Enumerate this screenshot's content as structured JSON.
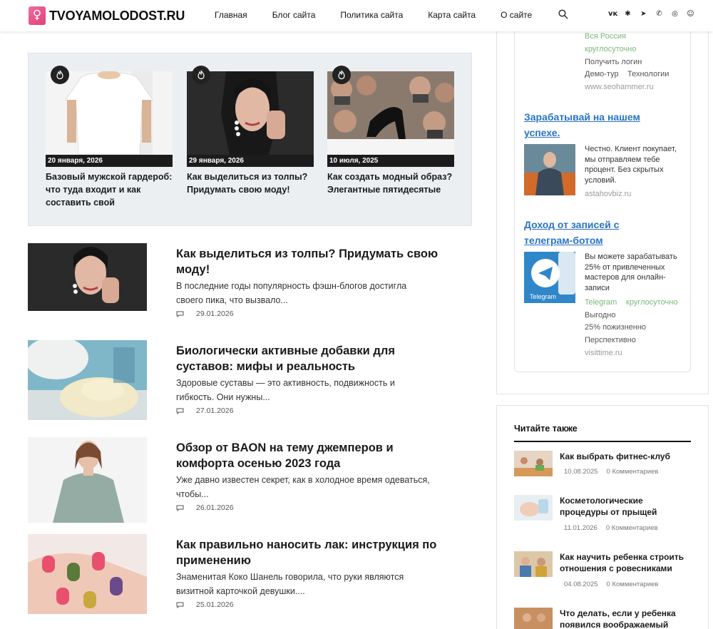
{
  "site": {
    "logo_text": "TVOYAMOLODOST.RU",
    "nav": [
      "Главная",
      "Блог сайта",
      "Политика сайта",
      "Карта сайта",
      "О сайте"
    ],
    "icons": [
      "search-icon",
      "vk-icon",
      "odnoklassniki-icon",
      "telegram-icon",
      "viber-icon",
      "whatsapp-icon",
      "yandex-zen-icon"
    ]
  },
  "featured": [
    {
      "date": "20 января, 2026",
      "title": "Базовый мужской гардероб: что туда входит и как составить свой"
    },
    {
      "date": "29 января, 2026",
      "title": "Как выделиться из толпы? Придумать свою моду!"
    },
    {
      "date": "10 июля, 2025",
      "title": "Как создать модный образ? Элегантные пятидесятые"
    }
  ],
  "posts": [
    {
      "title": "Как выделиться из толпы? Придумать свою моду!",
      "excerpt": "В последние годы популярность фэшн-блогов достигла своего пика, что вызвало...",
      "date": "29.01.2026"
    },
    {
      "title": "Биологически активные добавки для суставов: мифы и реальность",
      "excerpt": "Здоровые суставы — это активность, подвижность и гибкость. Они нужны...",
      "date": "27.01.2026"
    },
    {
      "title": "Обзор от BAON на тему джемперов и комфорта осенью 2023 года",
      "excerpt": "Уже давно известен секрет, как в холодное время одеваться, чтобы...",
      "date": "26.01.2026"
    },
    {
      "title": "Как правильно наносить лак: инструкция по применению",
      "excerpt": "Знаменитая Коко Шанель говорила, что руки являются визитной карточкой девушки....",
      "date": "25.01.2026"
    }
  ],
  "ads": {
    "first": {
      "lines": [
        "Вся Россия",
        "круглосуточно",
        "Получить логин"
      ],
      "tags": [
        "Демо-тур",
        "Технологии"
      ],
      "domain": "www.seohammer.ru"
    },
    "second": {
      "headline": "Зарабатывай на нашем успехе.",
      "text": "Честно. Клиент покупает, мы отправляем тебе процент. Без скрытых условий.",
      "domain": "astahovbiz.ru"
    },
    "third": {
      "headline": "Доход от записей с телеграм-ботом",
      "text": "Вы можете зарабатывать 25% от привлеченных мастеров для онлайн-записи",
      "tag1": "Telegram",
      "tag2": "круглосуточно",
      "lines": [
        "Выгодно",
        "25% пожизненно",
        "Перспективно"
      ],
      "domain": "visittime.ru"
    }
  },
  "also": {
    "title": "Читайте также",
    "items": [
      {
        "title": "Как выбрать фитнес-клуб",
        "date": "10.08.2025",
        "comments": "0 Комментариев"
      },
      {
        "title": "Косметологические процедуры от прыщей",
        "date": "11.01.2026",
        "comments": "0 Комментариев"
      },
      {
        "title": "Как научить ребенка строить отношения с ровесниками",
        "date": "04.08.2025",
        "comments": "0 Комментариев"
      },
      {
        "title": "Что делать, если у ребенка появился воображаемый",
        "date": "",
        "comments": ""
      }
    ]
  }
}
